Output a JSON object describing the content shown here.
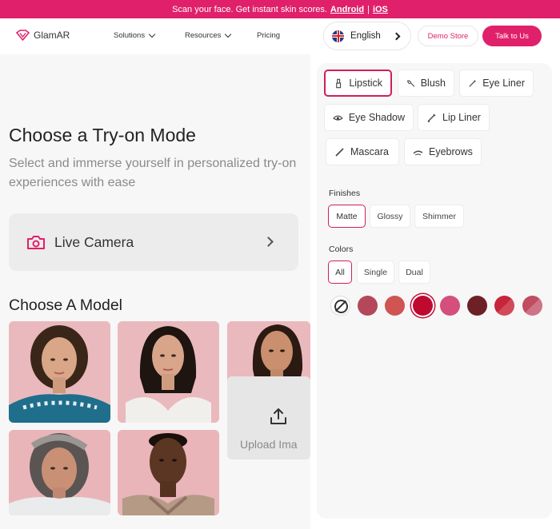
{
  "announcement": {
    "text": "Scan your face. Get instant skin scores.",
    "android": "Android",
    "separator": "|",
    "ios": "iOS"
  },
  "nav": {
    "logo": "GlamAR",
    "items": [
      {
        "label": "Solutions"
      },
      {
        "label": "Resources"
      },
      {
        "label": "Pricing"
      }
    ],
    "language": "English",
    "demo_store": "Demo Store",
    "talk_to_us": "Talk to Us"
  },
  "hero": {
    "title": "Choose a Try-on Mode",
    "subtitle": "Select and immerse yourself in personalized try-on experiences with ease",
    "live_camera": "Live Camera"
  },
  "models": {
    "title": "Choose A Model",
    "upload_label": "Upload Ima"
  },
  "panel": {
    "categories": [
      "Lipstick",
      "Blush",
      "Eye Liner",
      "Eye Shadow",
      "Lip Liner",
      "Mascara",
      "Eyebrows"
    ],
    "active_category": "Lipstick",
    "finishes_title": "Finishes",
    "finishes": [
      "Matte",
      "Glossy",
      "Shimmer"
    ],
    "active_finish": "Matte",
    "colors_title": "Colors",
    "color_filters": [
      "All",
      "Single",
      "Dual"
    ],
    "active_color_filter": "All",
    "swatches": [
      "#b5475a",
      "#cf5452",
      "#bf0a30",
      "#d44f7c",
      "#6e2027",
      "#c6263a/#d04a5a",
      "#c04d62/#cf7387"
    ],
    "selected_swatch": "#bf0a30",
    "accent": "#e0206a"
  }
}
